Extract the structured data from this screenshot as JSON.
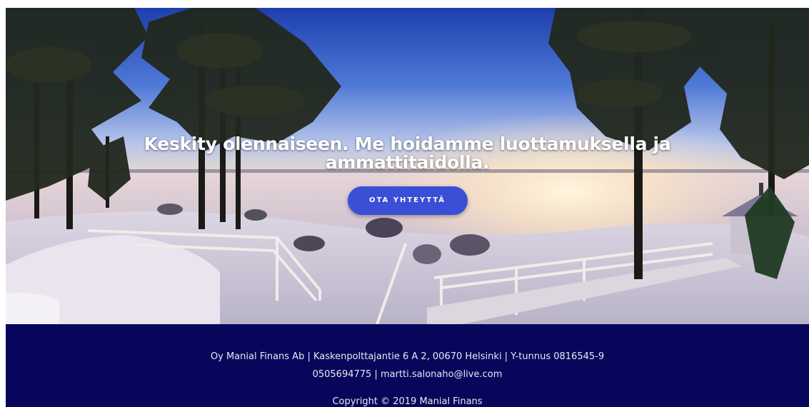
{
  "hero": {
    "headline": "Keskity olennaiseen. Me hoidamme luottamuksella ja ammattitaidolla.",
    "cta_label": "OTA YHTEYTTÄ",
    "image": "winter-seaside-pier-photo"
  },
  "footer": {
    "company_line": "Oy Manial Finans Ab | Kaskenpolttajantie 6 A 2, 00670 Helsinki | Y-tunnus 0816545-9",
    "contact_line": "0505694775 | martti.salonaho@live.com",
    "copyright": "Copyright © 2019 Manial Finans"
  },
  "colors": {
    "footer_bg": "#07065a",
    "cta_bg": "#3a4fd6",
    "text_light": "#ffffff"
  }
}
